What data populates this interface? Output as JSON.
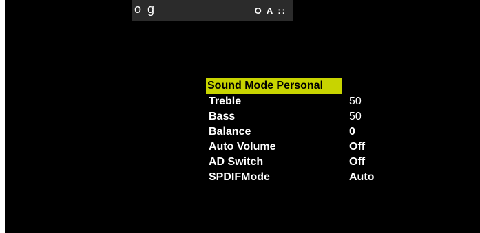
{
  "topbar": {
    "left_text": "o g",
    "right_text": "O A ::"
  },
  "menu": {
    "title": "Sound Mode Personal",
    "highlight_color": "#c8d400",
    "items": [
      {
        "label": "Treble",
        "value": "50"
      },
      {
        "label": "Bass",
        "value": "50"
      },
      {
        "label": "Balance",
        "value": "0"
      },
      {
        "label": "Auto Volume",
        "value": "Off"
      },
      {
        "label": "AD Switch",
        "value": "Off"
      },
      {
        "label": "SPDIFMode",
        "value": "Auto"
      }
    ]
  }
}
